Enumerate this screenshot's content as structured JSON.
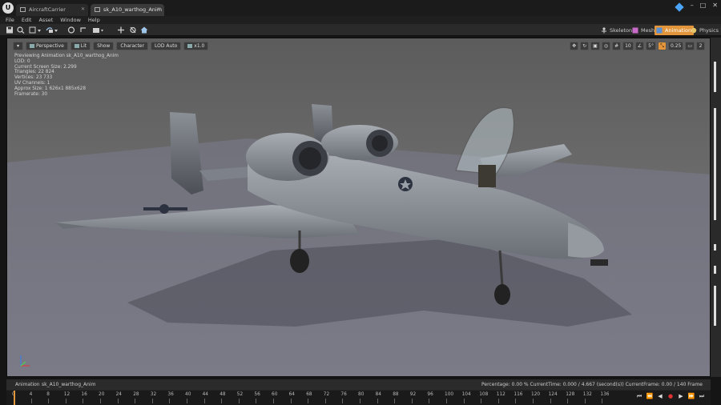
{
  "title_bar": {
    "logo": "U",
    "tabs": [
      {
        "label": "AircraftCarrier",
        "active": false
      },
      {
        "label": "sk_A10_warthog_Anim",
        "active": true
      }
    ]
  },
  "menu": [
    "File",
    "Edit",
    "Asset",
    "Window",
    "Help"
  ],
  "editor_modes": [
    {
      "label": "Skeleton",
      "active": false,
      "icon": "skeleton-icon"
    },
    {
      "label": "Mesh",
      "active": false,
      "icon": "mesh-icon"
    },
    {
      "label": "Animation",
      "active": true,
      "icon": "animation-icon"
    },
    {
      "label": "Physics",
      "active": false,
      "icon": "physics-icon"
    }
  ],
  "viewport": {
    "toolbar": {
      "perspective": "Perspective",
      "lit": "Lit",
      "show": "Show",
      "character": "Character",
      "lod": "LOD Auto",
      "speed": "x1.0"
    },
    "right_tools": {
      "grid_snap": "10",
      "rotation_snap": "5°",
      "scale_snap": "0.25",
      "camera_speed": "2"
    },
    "info_lines": [
      "Previewing Animation sk_A10_warthog_Anim",
      "LOD: 0",
      "Current Screen Size: 2.299",
      "Triangles: 22 824",
      "Vertices: 23 733",
      "UV Channels: 1",
      "Approx Size: 1 626x1 885x628",
      "Framerate: 30"
    ]
  },
  "timeline": {
    "label": "Animation",
    "anim_name": "sk_A10_warthog_Anim",
    "status": "Percentage:  0.00 % CurrentTime:  0.000 / 4.667 (second(s)) CurrentFrame:  0.00 / 140 Frame",
    "ticks": [
      "0",
      "4",
      "8",
      "12",
      "16",
      "20",
      "24",
      "28",
      "32",
      "36",
      "40",
      "44",
      "48",
      "52",
      "56",
      "60",
      "64",
      "68",
      "72",
      "76",
      "80",
      "84",
      "88",
      "92",
      "96",
      "100",
      "104",
      "108",
      "112",
      "116",
      "120",
      "124",
      "128",
      "132",
      "136"
    ],
    "controls": [
      "⏮",
      "⏪",
      "◀",
      "●",
      "▶",
      "⏩",
      "⏭"
    ]
  },
  "colors": {
    "accent": "#e2953a",
    "viewport_bg": "#6a6a6a",
    "aircraft": "#8a8f96"
  }
}
